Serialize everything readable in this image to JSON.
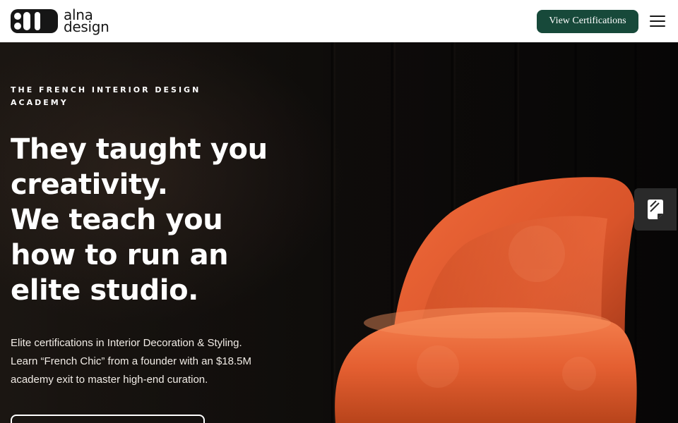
{
  "brand": {
    "name_line1": "alna",
    "name_line2": "design"
  },
  "header": {
    "cta_label": "View Certifications",
    "menu_icon": "hamburger-menu-icon"
  },
  "hero": {
    "eyebrow": "THE FRENCH INTERIOR DESIGN ACADEMY",
    "headline_lines": [
      "They taught you",
      "creativity.",
      "We teach you",
      "how to run an",
      "elite studio."
    ],
    "subcopy_lines": [
      "Elite certifications in Interior Decoration & Styling.",
      "Learn “French Chic” from a founder with an $18.5M",
      "academy exit to master high-end curation."
    ],
    "background_image": "orange-velvet-armchair-in-dark-room"
  },
  "side_widget": {
    "icon": "notepad-icon"
  },
  "colors": {
    "brand_green": "#17493a",
    "header_bg": "#ffffff",
    "hero_text": "#ffffff",
    "chair_orange": "#e0552a"
  }
}
